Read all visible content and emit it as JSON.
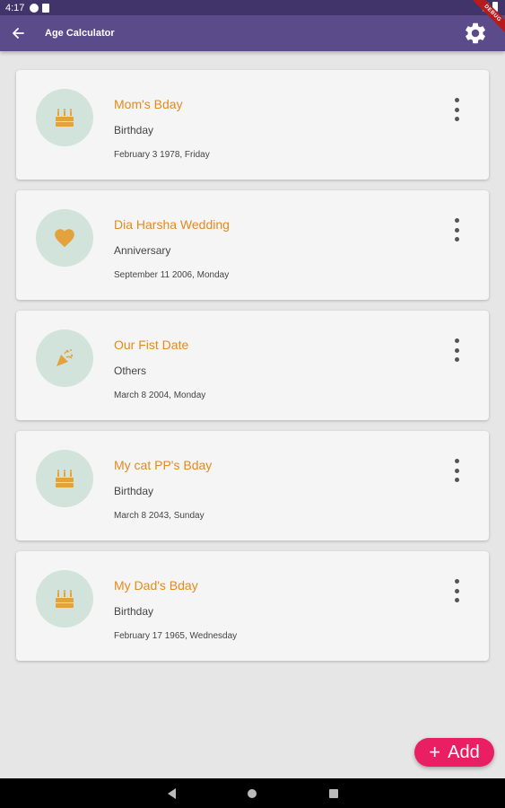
{
  "status_bar": {
    "time": "4:17"
  },
  "debug_banner": "DEBUG",
  "app_bar": {
    "title": "Age Calculator"
  },
  "colors": {
    "app_bar": "#5b4b8a",
    "status_bar": "#40346a",
    "title_accent": "#e38a1e",
    "avatar_bg": "#d2e3dc",
    "fab": "#e91e63"
  },
  "events": [
    {
      "title": "Mom's Bday",
      "type": "Birthday",
      "date": "February 3 1978, Friday",
      "icon": "cake-icon"
    },
    {
      "title": "Dia Harsha Wedding",
      "type": "Anniversary",
      "date": "September 11 2006, Monday",
      "icon": "heart-icon"
    },
    {
      "title": "Our Fist Date",
      "type": "Others",
      "date": "March 8 2004, Monday",
      "icon": "party-popper-icon"
    },
    {
      "title": "My cat PP's Bday",
      "type": "Birthday",
      "date": "March 8 2043, Sunday",
      "icon": "cake-icon"
    },
    {
      "title": "My Dad's Bday",
      "type": "Birthday",
      "date": "February 17 1965, Wednesday",
      "icon": "cake-icon"
    }
  ],
  "fab": {
    "label": "Add",
    "plus": "+"
  }
}
